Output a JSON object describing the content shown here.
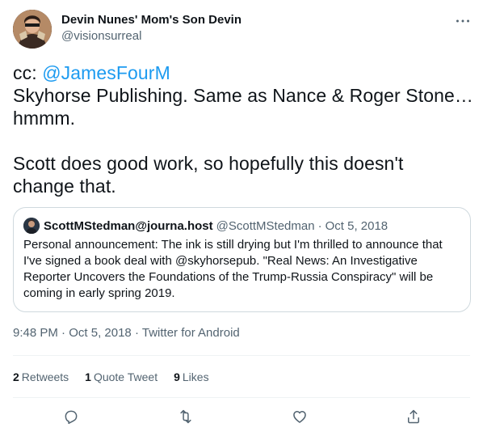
{
  "author": {
    "display_name": "Devin Nunes' Mom's Son Devin",
    "handle": "@visionsurreal",
    "avatar_icon": "avatar-icon"
  },
  "tweet": {
    "mention": "@JamesFourM",
    "cc_prefix": "cc: ",
    "line2": "Skyhorse Publishing. Same as Nance & Roger Stone…",
    "line3": "hmmm.",
    "line4": "Scott does good work, so hopefully this doesn't",
    "line5": "change that."
  },
  "quoted_tweet": {
    "display_name": "ScottMStedman@journa.host",
    "handle": "@ScottMStedman",
    "separator": "·",
    "date": "Oct 5, 2018",
    "lines": [
      "Personal announcement: The ink is still drying but I'm thrilled to announce that",
      "I've signed a book deal with @skyhorsepub. \"Real News: An Investigative",
      "Reporter Uncovers the Foundations of the Trump-Russia Conspiracy\" will be",
      "coming in early spring 2019."
    ]
  },
  "meta": {
    "time": "9:48 PM",
    "date": "Oct 5, 2018",
    "source": "Twitter for Android",
    "separator": "·"
  },
  "stats": {
    "retweets_count": "2",
    "retweets_label": "Retweets",
    "quotes_count": "1",
    "quotes_label": "Quote Tweet",
    "likes_count": "9",
    "likes_label": "Likes"
  },
  "colors": {
    "text": "#0f1419",
    "secondary": "#536471",
    "link": "#1d9bf0",
    "border": "#cfd9de",
    "divider": "#eff3f4"
  }
}
